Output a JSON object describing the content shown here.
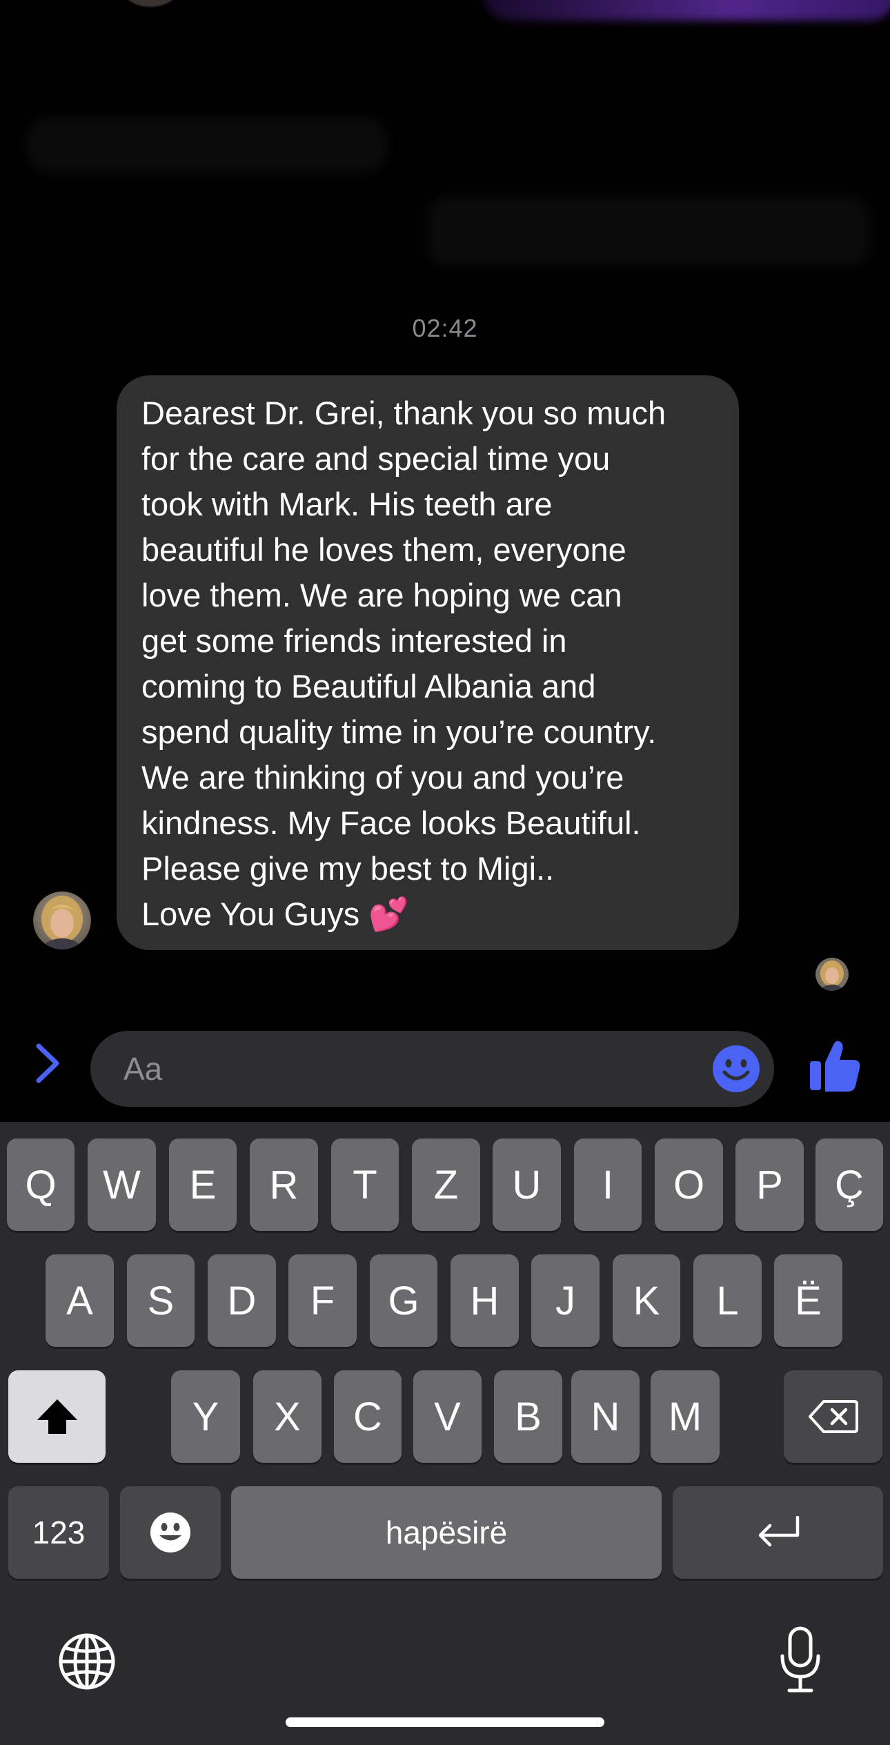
{
  "thread": {
    "timestamp": "02:42",
    "incoming_message": {
      "lines": [
        "Dearest Dr. Grei, thank you so much",
        "for the care and special time you",
        "took with Mark. His teeth are",
        "beautiful he loves them, everyone",
        "love them. We are hoping we can",
        "get some friends interested in",
        "coming to Beautiful Albania and",
        "spend quality time in you’re country.",
        "We are thinking of you and you’re",
        "kindness. My Face looks Beautiful.",
        "Please give my best to Migi..",
        "Love You Guys 💕"
      ]
    }
  },
  "composer": {
    "placeholder": "Aa",
    "accent_color": "#4a63f5"
  },
  "keyboard": {
    "row1": [
      "Q",
      "W",
      "E",
      "R",
      "T",
      "Z",
      "U",
      "I",
      "O",
      "P",
      "Ç"
    ],
    "row2": [
      "A",
      "S",
      "D",
      "F",
      "G",
      "H",
      "J",
      "K",
      "L",
      "Ë"
    ],
    "row3": [
      "Y",
      "X",
      "C",
      "V",
      "B",
      "N",
      "M"
    ],
    "numbers_label": "123",
    "space_label": "hapësirë",
    "icons": {
      "shift": "shift-icon",
      "backspace": "backspace-icon",
      "emoji": "emoji-icon",
      "return": "return-icon",
      "globe": "globe-icon",
      "mic": "microphone-icon"
    }
  }
}
